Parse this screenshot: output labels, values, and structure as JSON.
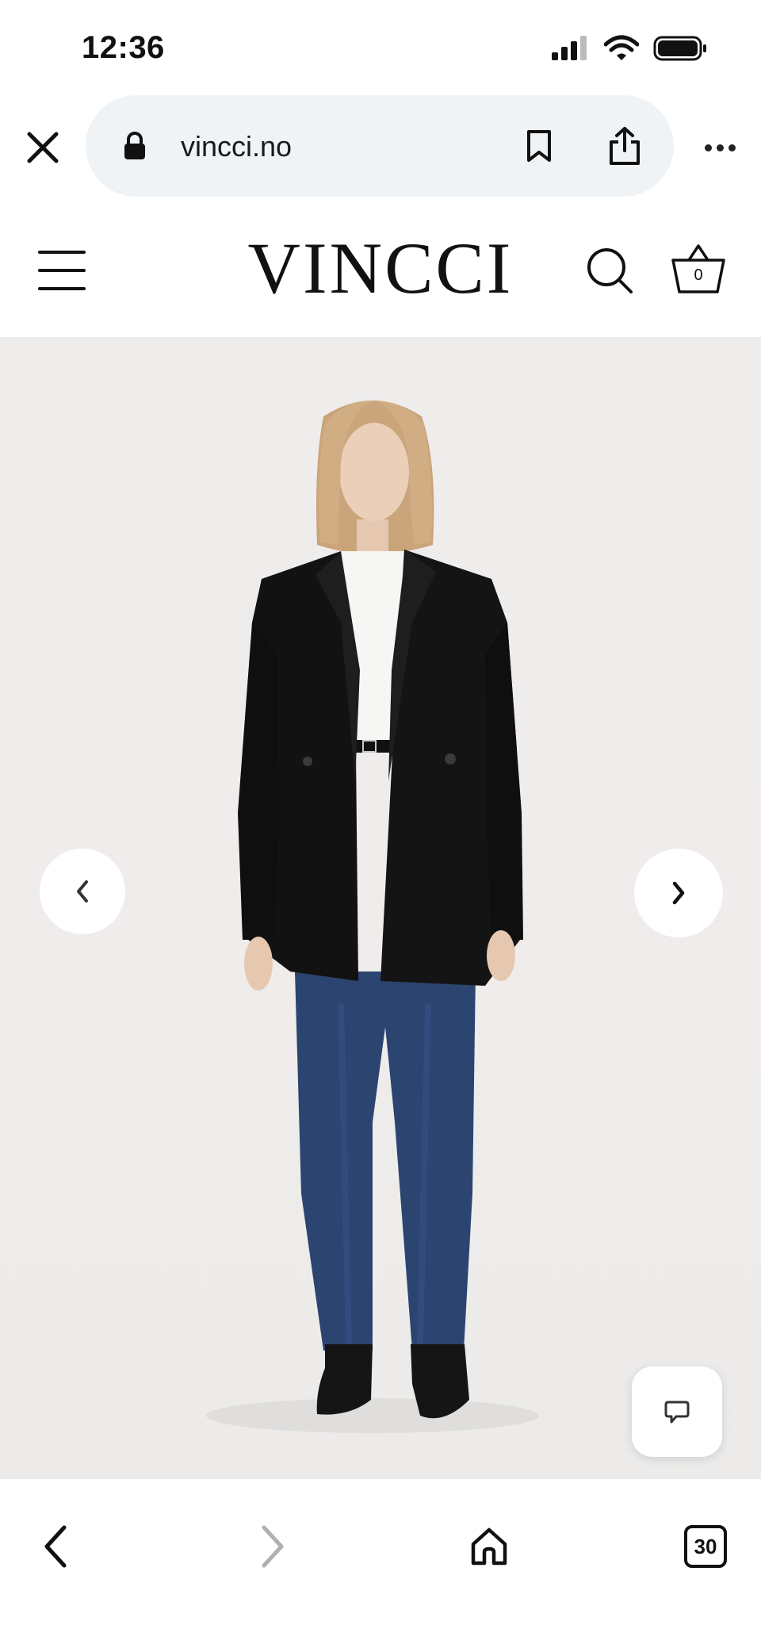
{
  "status_bar": {
    "time": "12:36",
    "icons": [
      "cellular-signal-icon",
      "wifi-icon",
      "battery-icon"
    ]
  },
  "browser": {
    "url": "vincci.no",
    "icons": [
      "close-icon",
      "lock-icon",
      "bookmark-icon",
      "share-icon",
      "more-icon"
    ]
  },
  "site_header": {
    "logo": "VINCCI",
    "cart_count": "0",
    "icons": [
      "menu-icon",
      "search-icon",
      "basket-icon"
    ]
  },
  "product_gallery": {
    "image": "model-black-blazer-jeans",
    "controls": [
      "chevron-left-icon",
      "chevron-right-icon",
      "chat-icon"
    ]
  },
  "bottom_toolbar": {
    "tabs_count": "30",
    "icons": [
      "back-icon",
      "forward-icon",
      "home-icon",
      "tabs-icon"
    ]
  },
  "colors": {
    "url_pill_bg": "#f0f3f5",
    "hero_bg": "#efedec",
    "blazer": "#121212",
    "denim": "#2b4470"
  }
}
